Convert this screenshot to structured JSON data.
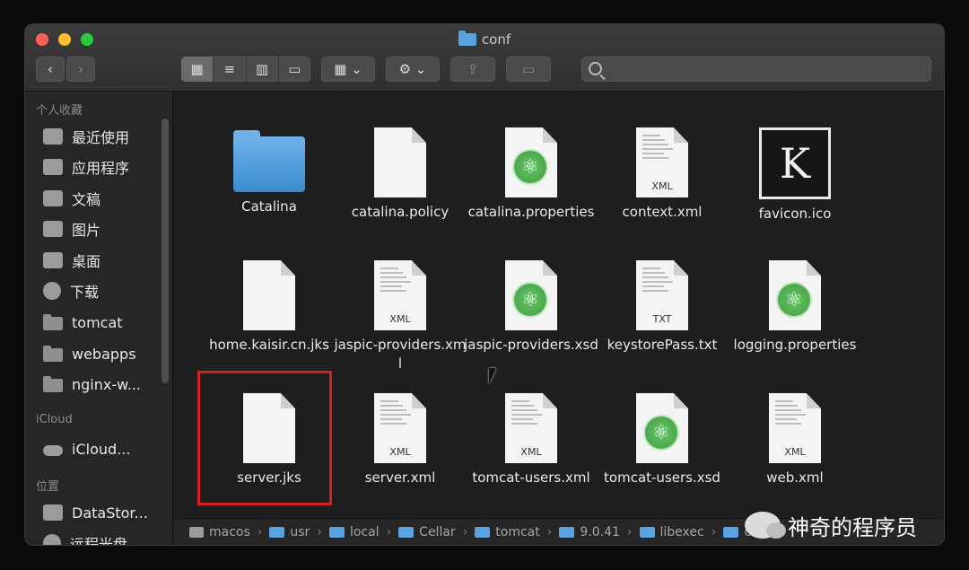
{
  "window": {
    "title": "conf"
  },
  "toolbar": {
    "back": "‹",
    "forward": "›",
    "view_icons": [
      "▦",
      "≡",
      "▥",
      "▭"
    ],
    "arrange": "▦ ⌄",
    "action": "⚙ ⌄",
    "share": "⇪",
    "tag": "▭"
  },
  "sidebar": {
    "sections": [
      {
        "heading": "个人收藏",
        "items": [
          {
            "label": "最近使用",
            "icon": "recents-icon"
          },
          {
            "label": "应用程序",
            "icon": "applications-icon"
          },
          {
            "label": "文稿",
            "icon": "documents-icon"
          },
          {
            "label": "图片",
            "icon": "pictures-icon"
          },
          {
            "label": "桌面",
            "icon": "desktop-icon"
          },
          {
            "label": "下载",
            "icon": "downloads-icon"
          },
          {
            "label": "tomcat",
            "icon": "folder-icon"
          },
          {
            "label": "webapps",
            "icon": "folder-icon"
          },
          {
            "label": "nginx-w...",
            "icon": "folder-icon"
          }
        ]
      },
      {
        "heading": "iCloud",
        "items": [
          {
            "label": "iCloud...",
            "icon": "icloud-icon"
          }
        ]
      },
      {
        "heading": "位置",
        "items": [
          {
            "label": "DataStor...",
            "icon": "disk-icon"
          },
          {
            "label": "远程光盘",
            "icon": "remote-disc-icon"
          }
        ]
      }
    ]
  },
  "files": [
    {
      "name": "Catalina",
      "kind": "folder"
    },
    {
      "name": "catalina.policy",
      "kind": "blank"
    },
    {
      "name": "catalina.properties",
      "kind": "atom"
    },
    {
      "name": "context.xml",
      "kind": "xml",
      "tag": "XML"
    },
    {
      "name": "favicon.ico",
      "kind": "k"
    },
    {
      "name": "home.kaisir.cn.jks",
      "kind": "blank"
    },
    {
      "name": "jaspic-providers.xml",
      "kind": "xml",
      "tag": "XML"
    },
    {
      "name": "jaspic-providers.xsd",
      "kind": "atom"
    },
    {
      "name": "keystorePass.txt",
      "kind": "xml",
      "tag": "TXT"
    },
    {
      "name": "logging.properties",
      "kind": "atom"
    },
    {
      "name": "server.jks",
      "kind": "blank",
      "selected": true
    },
    {
      "name": "server.xml",
      "kind": "xml",
      "tag": "XML"
    },
    {
      "name": "tomcat-users.xml",
      "kind": "xml",
      "tag": "XML"
    },
    {
      "name": "tomcat-users.xsd",
      "kind": "atom"
    },
    {
      "name": "web.xml",
      "kind": "xml",
      "tag": "XML"
    }
  ],
  "k_letter": "K",
  "pathbar": [
    "macos",
    "usr",
    "local",
    "Cellar",
    "tomcat",
    "9.0.41",
    "libexec",
    "co"
  ],
  "watermark": "神奇的程序员",
  "colors": {
    "highlight": "#d21f1f",
    "folder": "#5aa3e0",
    "accent_green": "#3c9d3c"
  }
}
